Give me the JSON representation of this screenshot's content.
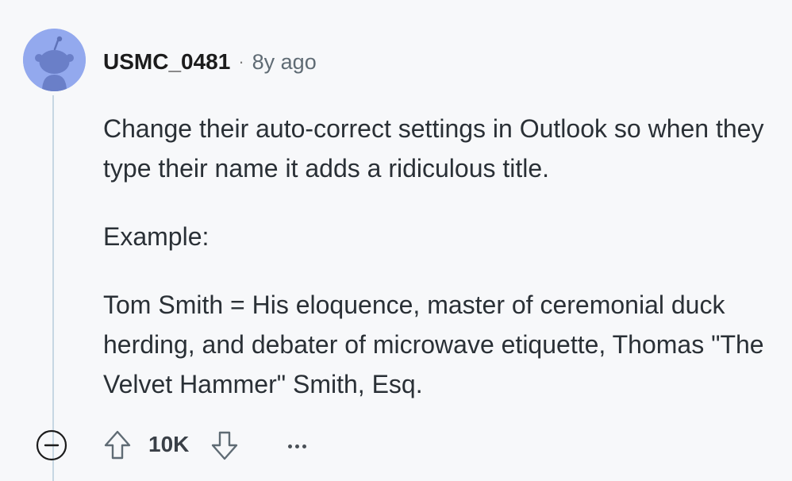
{
  "comment": {
    "username": "USMC_0481",
    "separator": "·",
    "timestamp": "8y ago",
    "paragraphs": [
      "Change their auto-correct settings in Outlook so when they type their name it adds a ridiculous title.",
      "Example:",
      "Tom Smith = His eloquence, master of ceremonial duck herding, and debater of microwave etiquette, Thomas \"The Velvet Hammer\" Smith, Esq."
    ]
  },
  "actions": {
    "vote_count": "10K",
    "collapse_icon": "collapse-minus-icon",
    "upvote_icon": "upvote-arrow-icon",
    "downvote_icon": "downvote-arrow-icon",
    "more_icon": "more-options-icon"
  },
  "colors": {
    "background": "#f7f8fa",
    "avatar_bg": "#93a9ee",
    "thread_line": "#c7d7e3",
    "text": "#2a3036",
    "muted": "#5f6b74"
  }
}
